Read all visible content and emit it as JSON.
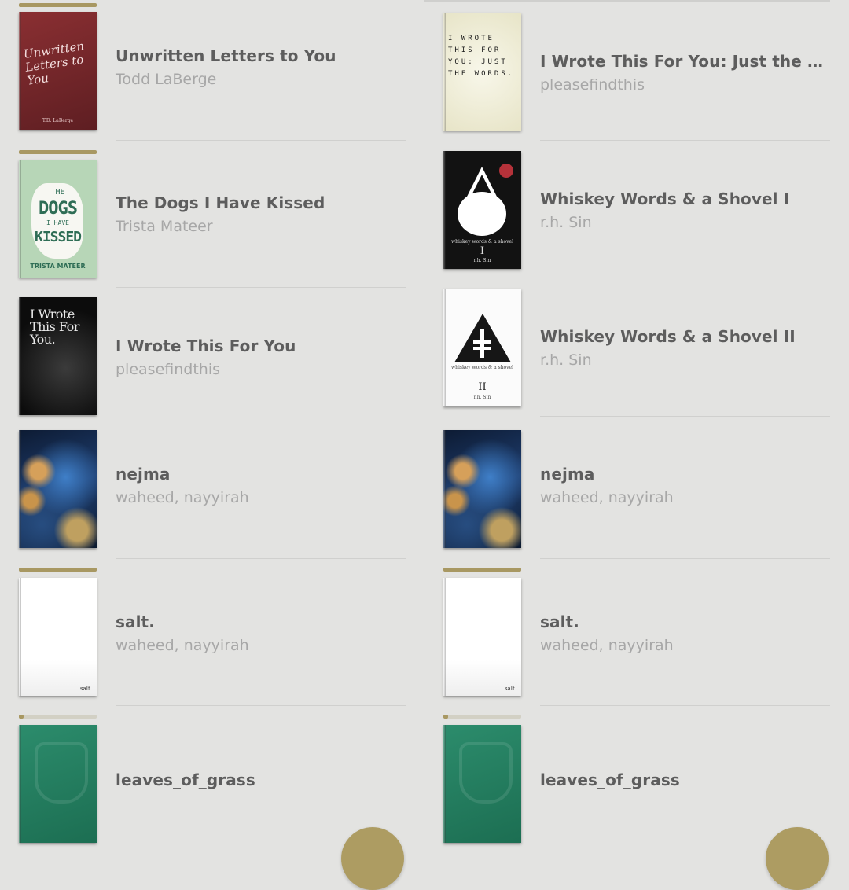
{
  "colors": {
    "background": "#e3e3e1",
    "accent": "#ad9c62",
    "title_text": "#5d5d5d",
    "author_text": "#a7a7a7"
  },
  "left_column": {
    "items": [
      {
        "title": "Unwritten Letters to You",
        "author": "Todd LaBerge",
        "cover_text": "Unwritten Letters to You",
        "cover_small": "T.D. LaBerge",
        "progress": 1.0
      },
      {
        "title": "The Dogs I Have Kissed",
        "author": "Trista Mateer",
        "cover_t1": "THE",
        "cover_t2": "DOGS",
        "cover_t2b": "I HAVE",
        "cover_t3": "KISSED",
        "cover_author": "TRISTA MATEER",
        "progress": 1.0
      },
      {
        "title": "I Wrote This For You",
        "author": "pleasefindthis",
        "cover_text": "I Wrote This For You.",
        "progress": 0.0
      },
      {
        "title": "nejma",
        "author": "waheed, nayyirah",
        "progress": 0.0
      },
      {
        "title": "salt.",
        "author": "waheed, nayyirah",
        "cover_corner": "salt.",
        "progress": 1.0
      },
      {
        "title": "leaves_of_grass",
        "author": "",
        "progress": 0.02
      }
    ]
  },
  "right_column": {
    "items": [
      {
        "title": "I Wrote This For You: Just the Words",
        "author": "pleasefindthis",
        "cover_text": "I WROTE THIS FOR YOU: JUST THE WORDS.",
        "progress": 0.0
      },
      {
        "title": "Whiskey Words & a Shovel I",
        "author": "r.h. Sin",
        "cover_c1": "whiskey words & a shovel",
        "cover_c2": "I",
        "cover_c3": "r.h. Sin",
        "progress": 0.0
      },
      {
        "title": "Whiskey Words & a Shovel II",
        "author": "r.h. Sin",
        "cover_c1": "whiskey words & a shovel",
        "cover_c2": "II",
        "cover_c3": "r.h. Sin",
        "progress": 0.0
      },
      {
        "title": "nejma",
        "author": "waheed, nayyirah",
        "progress": 0.0
      },
      {
        "title": "salt.",
        "author": "waheed, nayyirah",
        "cover_corner": "salt.",
        "progress": 1.0
      },
      {
        "title": "leaves_of_grass",
        "author": "",
        "progress": 0.02
      }
    ]
  }
}
